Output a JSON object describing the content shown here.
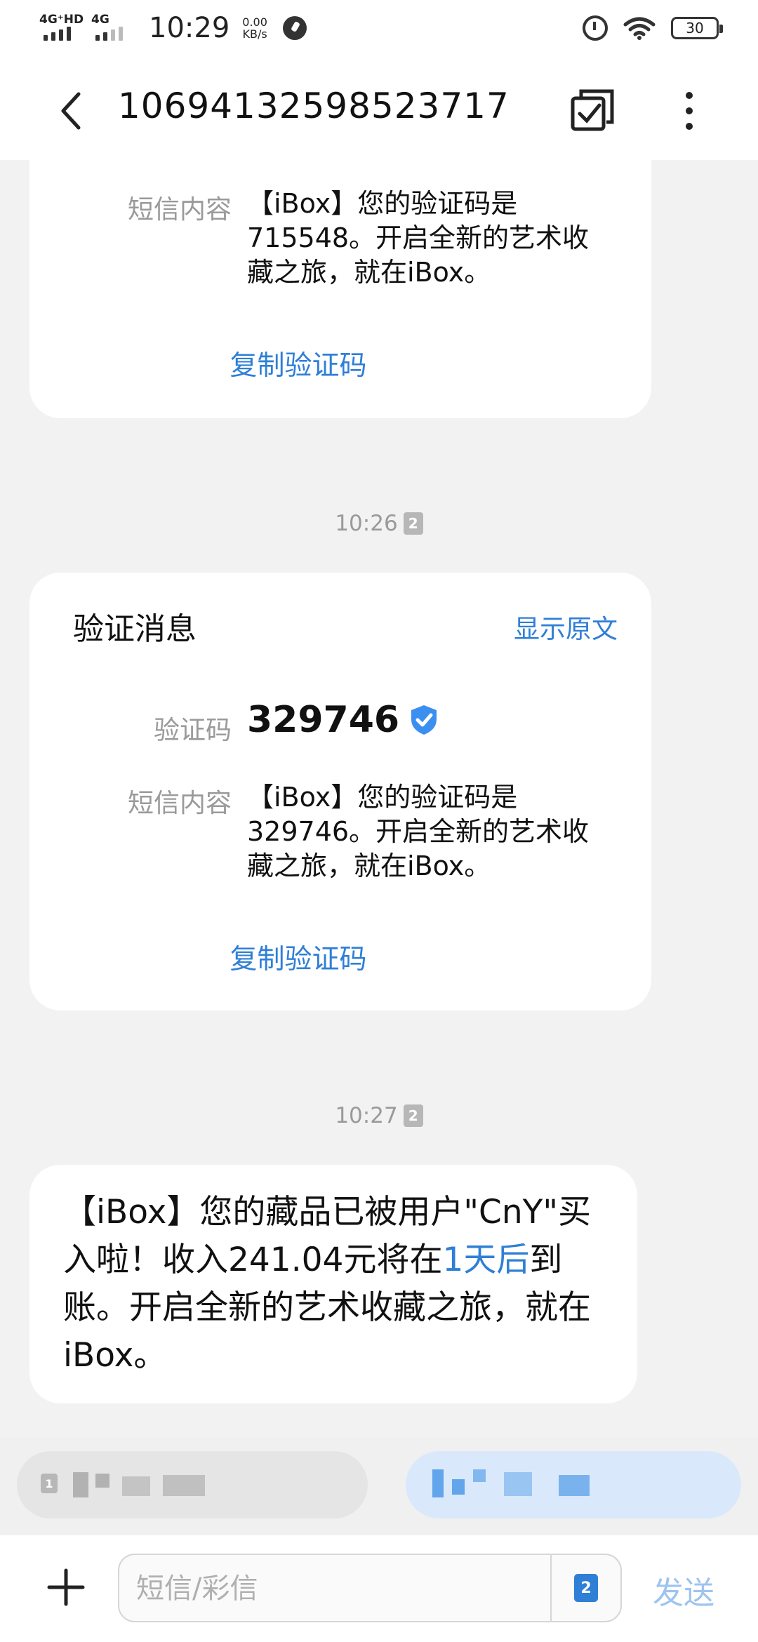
{
  "status_bar": {
    "signal1_label": "4G⁺HD",
    "signal2_label": "4G",
    "time": "10:29",
    "speed_value": "0.00",
    "speed_unit": "KB/s",
    "battery": "30"
  },
  "header": {
    "title": "10694132598523717"
  },
  "messages": [
    {
      "content_label": "短信内容",
      "content_text": "【iBox】您的验证码是715548。开启全新的艺术收藏之旅，就在iBox。",
      "copy_label": "复制验证码"
    },
    {
      "timestamp": "10:26",
      "sim": "2",
      "card_title": "验证消息",
      "show_original": "显示原文",
      "code_label": "验证码",
      "code_value": "329746",
      "content_label": "短信内容",
      "content_text": "【iBox】您的验证码是329746。开启全新的艺术收藏之旅，就在iBox。",
      "copy_label": "复制验证码"
    },
    {
      "timestamp": "10:27",
      "sim": "2",
      "body_before": "【iBox】您的藏品已被用户\"CnY\"买入啦！收入241.04元将在",
      "body_link": "1天后",
      "body_after": "到账。开启全新的艺术收藏之旅，就在iBox。"
    }
  ],
  "compose": {
    "placeholder": "短信/彩信",
    "sim": "2",
    "send_label": "发送"
  },
  "chips": {
    "left_sim": "1"
  },
  "colors": {
    "accent": "#2f7fd6",
    "background": "#f2f2f2"
  }
}
